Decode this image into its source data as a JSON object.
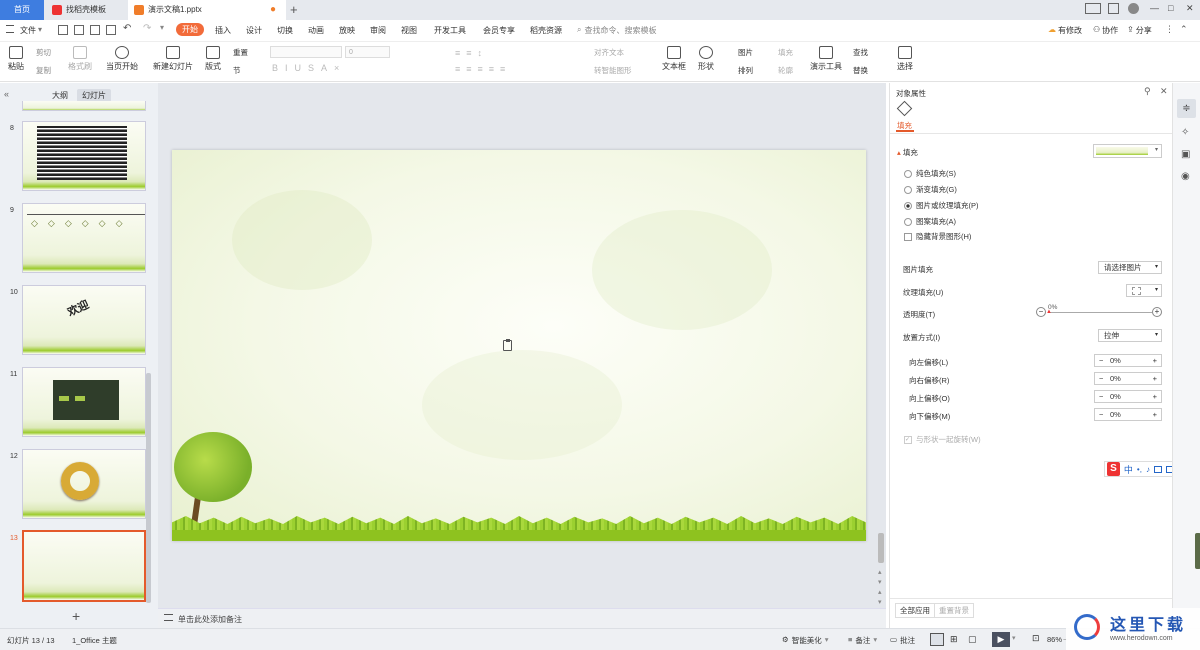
{
  "titlebar": {
    "home_tab": "首页",
    "tab_template": "找稻壳模板",
    "tab_doc": "演示文稿1.pptx",
    "new_tab": "+",
    "win_min": "—",
    "win_max": "□",
    "win_close": "✕"
  },
  "menubar": {
    "file": "文件",
    "items": [
      "开始",
      "插入",
      "设计",
      "切换",
      "动画",
      "放映",
      "审阅",
      "视图",
      "开发工具",
      "会员专享",
      "稻壳资源"
    ],
    "search": "查找命令、搜索模板",
    "has_changes": "有修改",
    "collab": "协作",
    "share": "分享"
  },
  "ribbon": {
    "paste": "粘贴",
    "cut": "剪切",
    "copy": "复制",
    "format_painter": "格式刷",
    "from_current": "当页开始",
    "new_slide": "新建幻灯片",
    "layout": "版式",
    "section": "节",
    "reset": "重置",
    "font_size": "0",
    "align_text": "对齐文本",
    "to_smartart": "转智能图形",
    "textbox": "文本框",
    "shape": "形状",
    "picture": "图片",
    "arrange": "排列",
    "fill": "填充",
    "outline": "轮廓",
    "present_tools": "演示工具",
    "find": "查找",
    "replace": "替换",
    "select": "选择"
  },
  "left_panel": {
    "tab_outline": "大纲",
    "tab_slides": "幻灯片",
    "slide_numbers": [
      "8",
      "9",
      "10",
      "11",
      "12",
      "13"
    ],
    "thumb10_text": "欢迎",
    "add_slide": "+"
  },
  "slide": {
    "paste_icon": "clipboard-icon"
  },
  "notes": {
    "placeholder": "单击此处添加备注"
  },
  "right_panel": {
    "title": "对象属性",
    "fill_tab": "填充",
    "section_fill": "填充",
    "opt_solid": "纯色填充(S)",
    "opt_gradient": "渐变填充(G)",
    "opt_picture": "图片或纹理填充(P)",
    "opt_pattern": "图案填充(A)",
    "opt_hide_bg": "隐藏背景图形(H)",
    "picture_fill_label": "图片填充",
    "picture_fill_value": "请选择图片",
    "texture_label": "纹理填充(U)",
    "transparency_label": "透明度(T)",
    "transparency_value": "0%",
    "placement_label": "放置方式(I)",
    "placement_value": "拉伸",
    "offset_left": "向左偏移(L)",
    "offset_right": "向右偏移(R)",
    "offset_up": "向上偏移(O)",
    "offset_down": "向下偏移(M)",
    "offset_value": "0%",
    "rotate_with_shape": "与形状一起旋转(W)",
    "apply_all": "全部应用",
    "reset_bg": "重置背景",
    "ime_chars": [
      "中",
      "•,"
    ]
  },
  "statusbar": {
    "slide_info": "幻灯片 13 / 13",
    "theme": "1_Office 主题",
    "smart_beautify": "智能美化",
    "notes": "备注",
    "comments": "批注",
    "zoom": "86%"
  },
  "watermark": {
    "text": "这里下载",
    "url": "www.herodown.com"
  },
  "colors": {
    "accent": "#f26b3a",
    "home_tab": "#3e7de0",
    "selected_thumb": "#e45a2b",
    "grass": "#8ec21f"
  }
}
